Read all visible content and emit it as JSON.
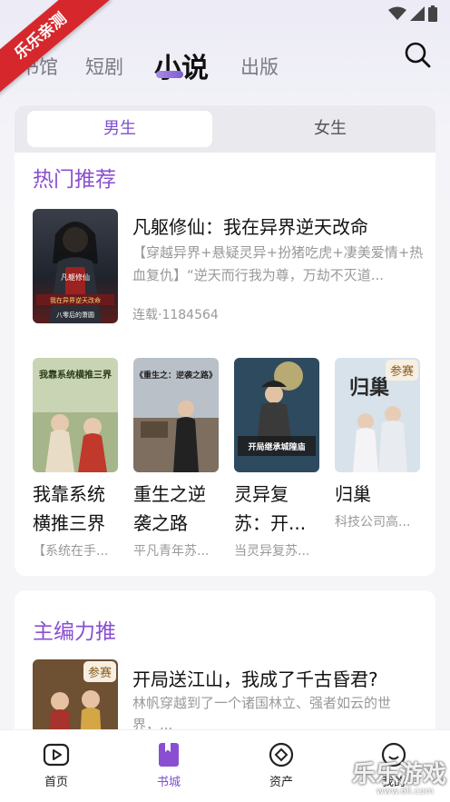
{
  "ribbon": {
    "label": "乐乐亲测"
  },
  "top_nav": {
    "tabs": [
      {
        "label": "书馆",
        "active": false
      },
      {
        "label": "短剧",
        "active": false
      },
      {
        "label": "小说",
        "active": true
      },
      {
        "label": "出版",
        "active": false
      }
    ]
  },
  "gender_switch": {
    "options": [
      "男生",
      "女生"
    ],
    "selected": "男生"
  },
  "hot": {
    "title": "热门推荐",
    "featured": {
      "title": "凡躯修仙：我在异界逆天改命",
      "desc": "【穿越异界+悬疑灵异+扮猪吃虎+凄美爱情+热血复仇】“逆天而行我为尊，万劫不灭道...",
      "meta": "连载·1184564",
      "cover_text": "凡躯修仙",
      "cover_sub": "我在异界逆天改命",
      "cover_author": "八零后的萧圆"
    },
    "grid": [
      {
        "title": "我靠系统横推三界",
        "desc": "【系统在手...",
        "cover_text": "我靠系统横推三界"
      },
      {
        "title": "重生之逆袭之路",
        "desc": "平凡青年苏...",
        "cover_text": "《重生之：逆袭之路》"
      },
      {
        "title": "灵异复苏：开...",
        "desc": "当灵异复苏...",
        "cover_text": "开局继承城隍庙"
      },
      {
        "title": "归巢",
        "desc": "科技公司高...",
        "cover_text": "归巢",
        "badge": "参赛"
      }
    ]
  },
  "editor": {
    "title": "主编力推",
    "item": {
      "title": "开局送江山，我成了千古昏君?",
      "desc": "林帆穿越到了一个诸国林立、强者如云的世界，...",
      "badge": "参赛"
    }
  },
  "bottom_nav": [
    {
      "label": "首页",
      "icon": "play-icon",
      "active": false
    },
    {
      "label": "书城",
      "icon": "book-icon",
      "active": true
    },
    {
      "label": "资产",
      "icon": "diamond-icon",
      "active": false
    },
    {
      "label": "我的",
      "icon": "smile-icon",
      "active": false
    }
  ],
  "watermark": {
    "text": "乐乐游戏",
    "url": "www.6ll.com"
  },
  "colors": {
    "accent": "#7c4fd0",
    "title_purple": "#8a4fd0",
    "ribbon_red": "#d6282c"
  }
}
